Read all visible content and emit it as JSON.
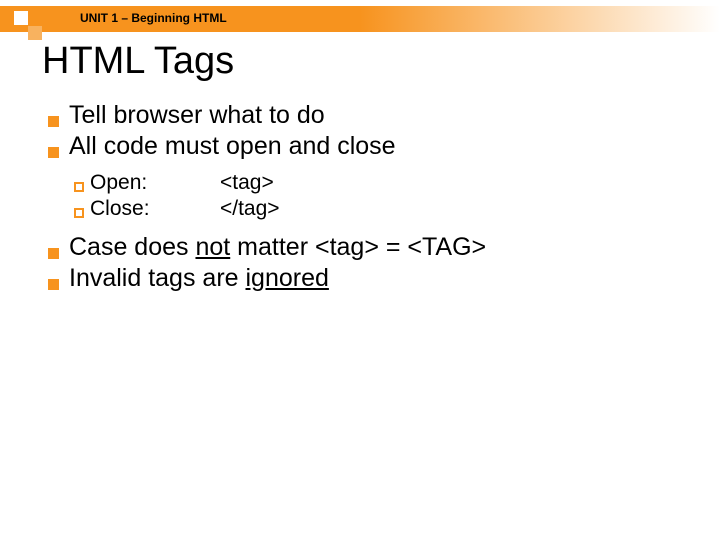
{
  "header": {
    "unit": "UNIT 1 – Beginning HTML"
  },
  "title": "HTML Tags",
  "bullets": {
    "b1": "Tell browser what to do",
    "b2": "All code must open and close",
    "b3_pre": "Case does ",
    "b3_not": "not",
    "b3_post": " matter <tag> = <TAG>",
    "b4_pre": "Invalid tags are ",
    "b4_ignored": "ignored"
  },
  "sub": {
    "open_label": "Open:",
    "open_value": "<tag>",
    "close_label": "Close:",
    "close_value": "</tag>"
  }
}
